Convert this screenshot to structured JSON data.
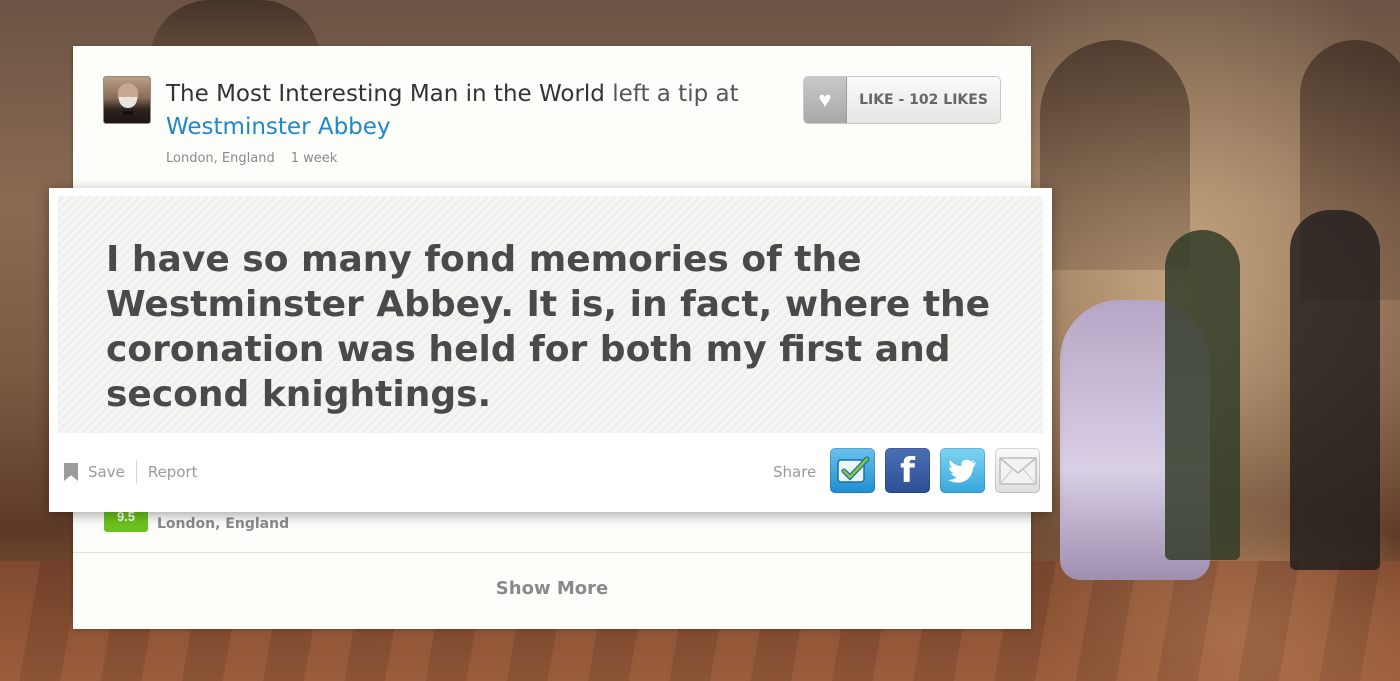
{
  "tip": {
    "author": "The Most Interesting Man in the World",
    "action": " left a tip at ",
    "venue": "Westminster Abbey",
    "location": "London, England",
    "age": "1 week",
    "text": "I have so many fond memories of the Westminster Abbey. It is, in fact, where the coronation was held for both my first and second knightings."
  },
  "like": {
    "label": "LIKE - 102 LIKES",
    "icon": "heart-icon"
  },
  "actions": {
    "save_label": "Save",
    "report_label": "Report",
    "share_label": "Share",
    "share_targets": [
      "foursquare",
      "facebook",
      "twitter",
      "email"
    ]
  },
  "venue_card": {
    "score": "9.5",
    "location": "London, England"
  },
  "show_more_label": "Show More",
  "colors": {
    "link": "#1e88c8",
    "score_green": "#6cc31d"
  }
}
